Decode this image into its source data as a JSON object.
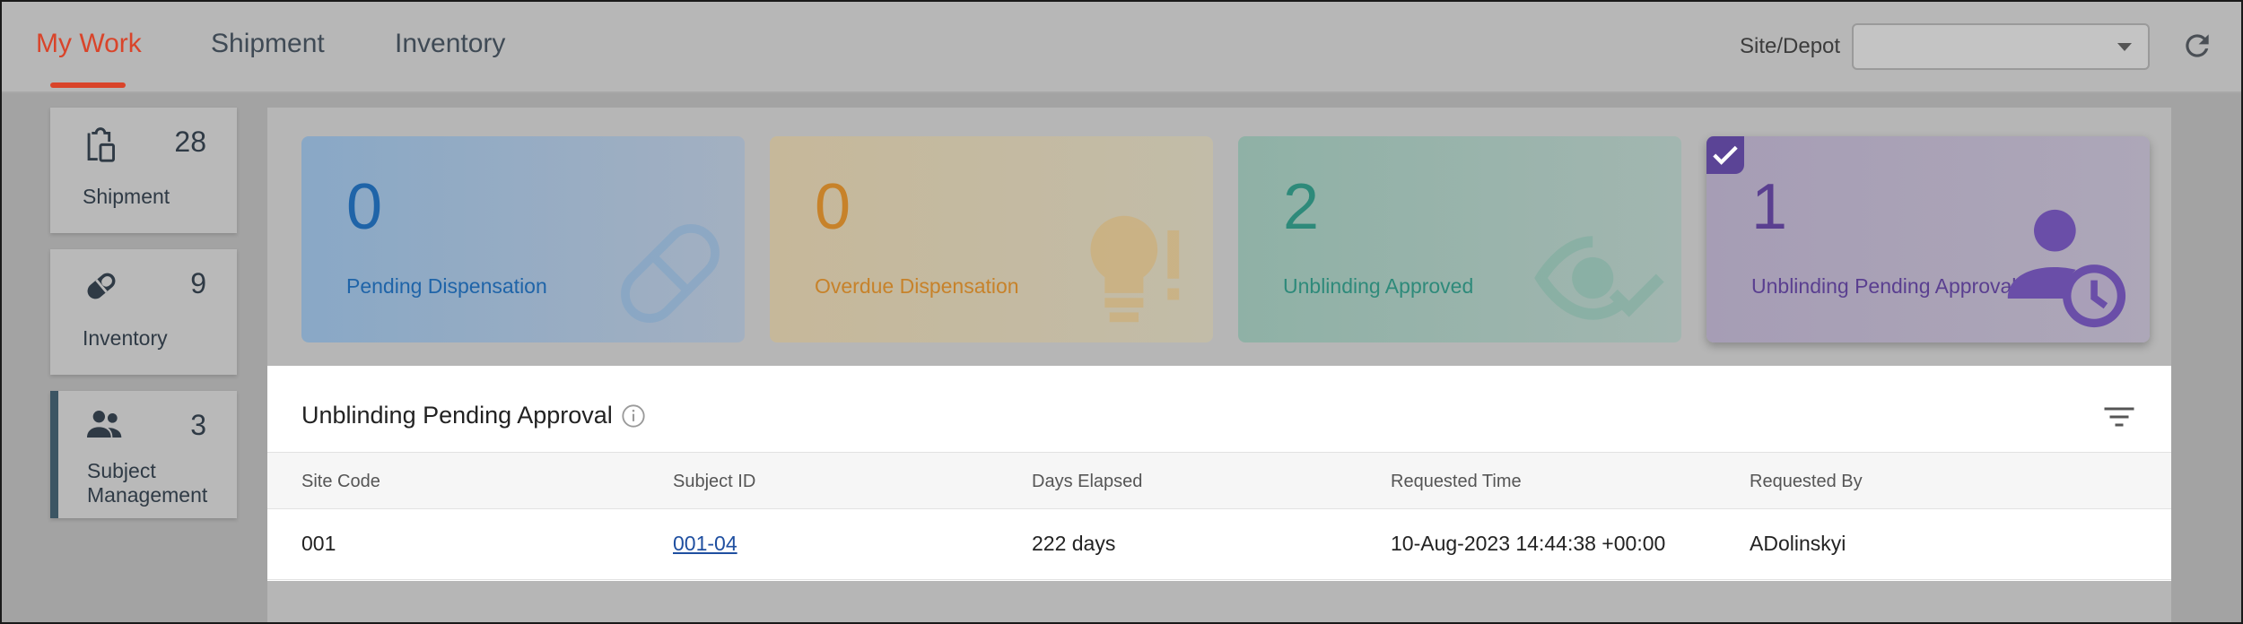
{
  "nav": {
    "tabs": [
      {
        "label": "My Work",
        "active": true
      },
      {
        "label": "Shipment",
        "active": false
      },
      {
        "label": "Inventory",
        "active": false
      }
    ],
    "site_label": "Site/Depot",
    "site_value": "",
    "refresh_icon": "refresh-icon",
    "accent_color": "#d9442a"
  },
  "sidebar": {
    "items": [
      {
        "label": "Shipment",
        "count": "28",
        "icon": "clipboard-icon"
      },
      {
        "label": "Inventory",
        "count": "9",
        "icon": "pill-icon"
      },
      {
        "label": "Subject Management",
        "count": "3",
        "icon": "people-icon",
        "active": true
      }
    ]
  },
  "kpis": [
    {
      "value": "0",
      "label": "Pending Dispensation",
      "icon": "capsule-icon",
      "color": "#1f64a8"
    },
    {
      "value": "0",
      "label": "Overdue Dispensation",
      "icon": "bulb-alert-icon",
      "color": "#c7822a"
    },
    {
      "value": "2",
      "label": "Unblinding Approved",
      "icon": "eye-check-icon",
      "color": "#2e8a7a"
    },
    {
      "value": "1",
      "label": "Unblinding Pending Approval",
      "icon": "user-clock-icon",
      "color": "#5a3f90",
      "selected": true
    }
  ],
  "table": {
    "title": "Unblinding Pending Approval",
    "columns": [
      "Site Code",
      "Subject ID",
      "Days Elapsed",
      "Requested Time",
      "Requested By"
    ],
    "rows": [
      [
        "001",
        "001-04",
        "222 days",
        "10-Aug-2023 14:44:38 +00:00",
        "ADolinskyi"
      ]
    ]
  }
}
